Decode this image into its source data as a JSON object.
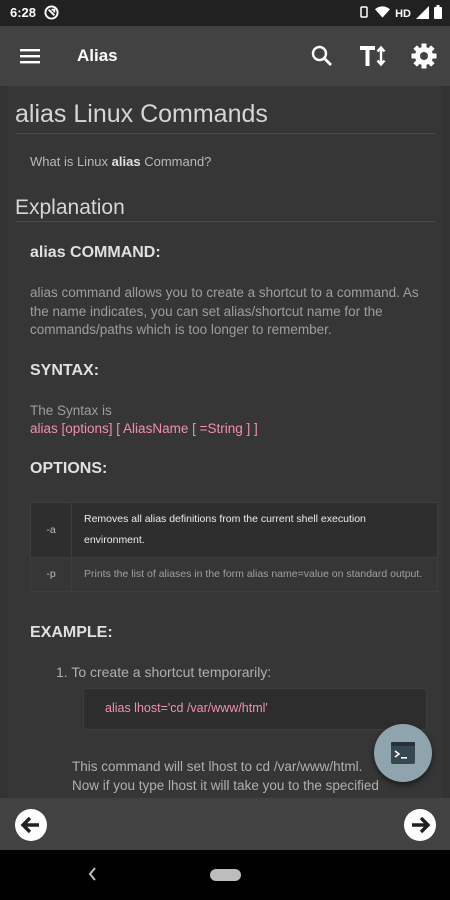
{
  "status_bar": {
    "time": "6:28",
    "network": "HD"
  },
  "app_bar": {
    "title": "Alias"
  },
  "content": {
    "page_title": "alias Linux Commands",
    "question_prefix": "What is Linux",
    "question_cmd": "alias",
    "question_suffix": "Command?",
    "section_heading": "Explanation",
    "command_heading": "alias COMMAND:",
    "description": "alias command allows you to create a shortcut to a command. As the name indicates, you can set alias/shortcut name for the commands/paths which is too longer to remember.",
    "syntax_heading": "SYNTAX:",
    "syntax_intro": "The Syntax is",
    "syntax_line": "alias [options] [ AliasName [ =String ] ]",
    "options_heading": "OPTIONS:",
    "options": [
      {
        "flag": "-a",
        "description": "Removes all alias definitions from the current shell execution environment."
      },
      {
        "flag": "-p",
        "description": "Prints the list of aliases in the form alias name=value on standard output."
      }
    ],
    "example_heading": "EXAMPLE:",
    "example_item": "1.  To create a shortcut temporarily:",
    "example_code": "alias lhost='cd /var/www/html'",
    "example_after_1": "This command will set lhost to cd /var/www/html.",
    "example_after_2": "Now if you type lhost it will take you to the specified"
  },
  "colors": {
    "background": "#333333",
    "app_bar": "#424242",
    "code_text": "#f48fb1",
    "fab": "#90a4ae"
  }
}
